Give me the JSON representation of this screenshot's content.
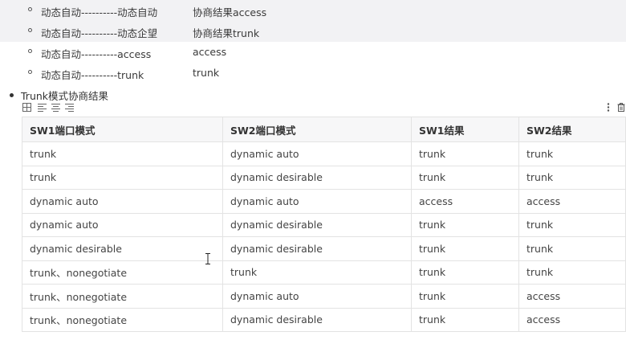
{
  "sub_items": [
    {
      "left": "动态自动----------动态自动",
      "right": "协商结果access"
    },
    {
      "left": "动态自动----------动态企望",
      "right": "协商结果trunk"
    },
    {
      "left": "动态自动----------access",
      "right": "access"
    },
    {
      "left": "动态自动----------trunk",
      "right": "trunk"
    }
  ],
  "bullet": {
    "text": "Trunk模式协商结果"
  },
  "toolbar": {
    "icons": [
      "table-grid-icon",
      "align-left-icon",
      "align-center-icon",
      "align-right-icon",
      "more-vertical-icon",
      "trash-icon"
    ]
  },
  "table": {
    "headers": [
      "SW1端口模式",
      "SW2端口模式",
      "SW1结果",
      "SW2结果"
    ],
    "rows": [
      [
        "trunk",
        "dynamic auto",
        "trunk",
        "trunk"
      ],
      [
        "trunk",
        "dynamic desirable",
        "trunk",
        "trunk"
      ],
      [
        "dynamic auto",
        "dynamic auto",
        "access",
        "access"
      ],
      [
        "dynamic auto",
        "dynamic desirable",
        "trunk",
        "trunk"
      ],
      [
        "dynamic desirable",
        "dynamic desirable",
        "trunk",
        "trunk"
      ],
      [
        "trunk、nonegotiate",
        "trunk",
        "trunk",
        "trunk"
      ],
      [
        "trunk、nonegotiate",
        "dynamic auto",
        "trunk",
        "access"
      ],
      [
        "trunk、nonegotiate",
        "dynamic desirable",
        "trunk",
        "access"
      ]
    ]
  }
}
